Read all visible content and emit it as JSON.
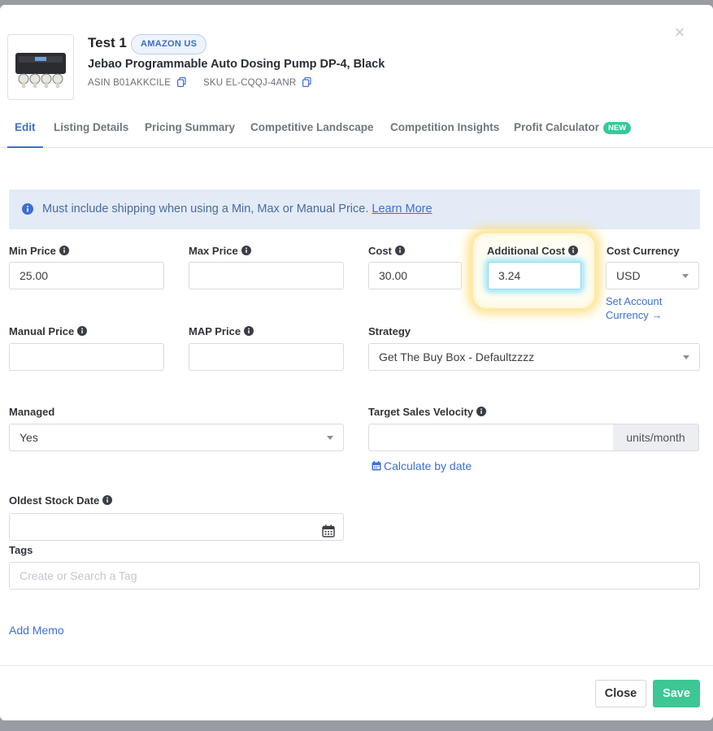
{
  "header": {
    "title": "Test 1",
    "marketplace_badge": "AMAZON US",
    "product_name": "Jebao Programmable Auto Dosing Pump DP-4, Black",
    "asin_label": "ASIN",
    "asin_value": "B01AKKCILE",
    "sku_label": "SKU",
    "sku_value": "EL-CQQJ-4ANR",
    "close_symbol": "×"
  },
  "tabs": [
    {
      "label": "Edit",
      "active": true
    },
    {
      "label": "Listing Details"
    },
    {
      "label": "Pricing Summary"
    },
    {
      "label": "Competitive Landscape"
    },
    {
      "label": "Competition Insights"
    },
    {
      "label": "Profit Calculator",
      "badge": "NEW"
    }
  ],
  "banner": {
    "text": "Must include shipping when using a Min, Max or Manual Price.",
    "link": "Learn More"
  },
  "form": {
    "min_price": {
      "label": "Min Price",
      "value": "25.00"
    },
    "max_price": {
      "label": "Max Price",
      "value": ""
    },
    "cost": {
      "label": "Cost",
      "value": "30.00"
    },
    "additional_cost": {
      "label": "Additional Cost",
      "value": "3.24"
    },
    "cost_currency": {
      "label": "Cost Currency",
      "value": "USD",
      "link_line1": "Set Account",
      "link_line2": "Currency →"
    },
    "manual_price": {
      "label": "Manual Price",
      "value": ""
    },
    "map_price": {
      "label": "MAP Price",
      "value": ""
    },
    "strategy": {
      "label": "Strategy",
      "value": "Get The Buy Box - Defaultzzzz"
    },
    "managed": {
      "label": "Managed",
      "value": "Yes"
    },
    "target_sales_velocity": {
      "label": "Target Sales Velocity",
      "value": "",
      "units": "units/month",
      "calc_link": "Calculate by date"
    },
    "oldest_stock_date": {
      "label": "Oldest Stock Date",
      "value": ""
    },
    "tags": {
      "label": "Tags",
      "placeholder": "Create or Search a Tag"
    },
    "add_memo": "Add Memo"
  },
  "footer": {
    "close_label": "Close",
    "save_label": "Save"
  },
  "colors": {
    "accent": "#3d6fd1",
    "save": "#3cc795",
    "new_badge": "#36c89a",
    "banner_bg": "#e3ebf7"
  }
}
